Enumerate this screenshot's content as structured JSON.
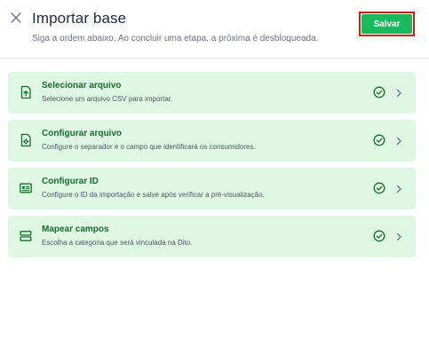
{
  "header": {
    "title": "Importar base",
    "subtitle": "Siga a ordem abaixo. Ao concluir uma etapa, a próxima é desbloqueada.",
    "save_label": "Salvar"
  },
  "colors": {
    "accent": "#17b95a",
    "step_bg": "#dff8e3",
    "step_title": "#186b2f",
    "highlight_border": "#d11a1a"
  },
  "steps": [
    {
      "title": "Selecionar arquivo",
      "description": "Selecione um arquivo CSV para importar.",
      "icon": "file-upload-icon",
      "status": "completed"
    },
    {
      "title": "Configurar arquivo",
      "description": "Configure o separador e o campo que identificará os consumidores.",
      "icon": "file-settings-icon",
      "status": "completed"
    },
    {
      "title": "Configurar ID",
      "description": "Configure o ID da importação e salve após verificar a pré-visualização.",
      "icon": "id-card-icon",
      "status": "completed"
    },
    {
      "title": "Mapear campos",
      "description": "Escolha a categoria que será vinculada na Dito.",
      "icon": "fields-map-icon",
      "status": "completed"
    }
  ]
}
